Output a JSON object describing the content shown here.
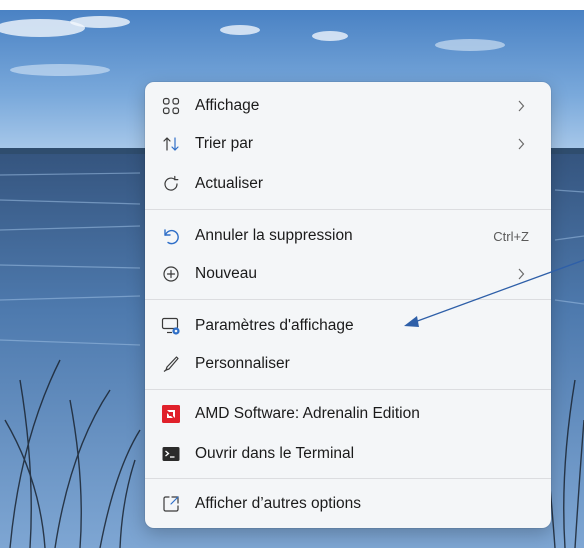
{
  "menu": {
    "items": [
      {
        "label": "Affichage",
        "icon": "view-grid-icon",
        "submenu": true
      },
      {
        "label": "Trier par",
        "icon": "sort-icon",
        "submenu": true
      },
      {
        "label": "Actualiser",
        "icon": "refresh-icon",
        "submenu": false
      },
      {
        "label": "Annuler la suppression",
        "icon": "undo-icon",
        "shortcut": "Ctrl+Z"
      },
      {
        "label": "Nouveau",
        "icon": "new-plus-icon",
        "submenu": true
      },
      {
        "label": "Paramètres d'affichage",
        "icon": "display-settings-icon"
      },
      {
        "label": "Personnaliser",
        "icon": "pen-brush-icon"
      },
      {
        "label": "AMD Software: Adrenalin Edition",
        "icon": "amd-logo-icon"
      },
      {
        "label": "Ouvrir dans le Terminal",
        "icon": "terminal-icon"
      },
      {
        "label": "Afficher d’autres options",
        "icon": "more-options-icon"
      }
    ]
  },
  "colors": {
    "menu_background": "#f4f6f8",
    "accent_blue": "#2f6fc8",
    "amd_red": "#e0212b",
    "annotation_arrow": "#2e5fa8"
  }
}
